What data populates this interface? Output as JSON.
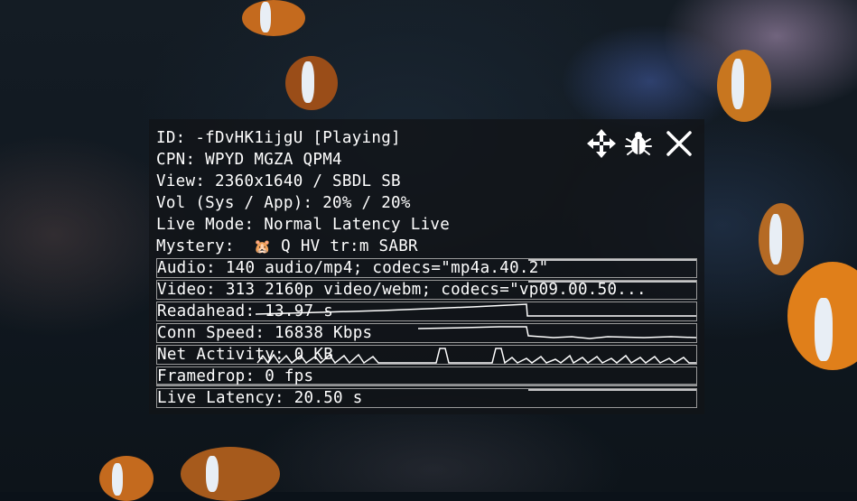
{
  "stats": {
    "id_line": "ID: -fDvHK1ijgU [Playing]",
    "cpn_line": "CPN: WPYD MGZA QPM4",
    "view_line": "View: 2360x1640 / SBDL SB",
    "vol_line": "Vol (Sys / App): 20% / 20%",
    "live_mode_line": "Live Mode: Normal Latency Live",
    "mystery_prefix": "Mystery:  ",
    "mystery_emoji": "🐹",
    "mystery_suffix": " Q HV tr:m SABR",
    "audio_line": "Audio: 140 audio/mp4; codecs=\"mp4a.40.2\"",
    "video_line": "Video: 313 2160p video/webm; codecs=\"vp09.00.50...",
    "readahead_line": "Readahead: 13.97 s",
    "conn_speed_line": "Conn Speed: 16838 Kbps",
    "net_activity_line": "Net Activity: 0 KB",
    "framedrop_line": "Framedrop: 0 fps",
    "live_latency_line": "Live Latency: 20.50 s"
  },
  "controls": {
    "move_icon": "move-arrows-icon",
    "debug_icon": "bug-icon",
    "close_icon": "close-icon"
  },
  "colors": {
    "panel_bg": "#121418",
    "text": "#ffffff",
    "graph_border": "#9a9a9a"
  }
}
